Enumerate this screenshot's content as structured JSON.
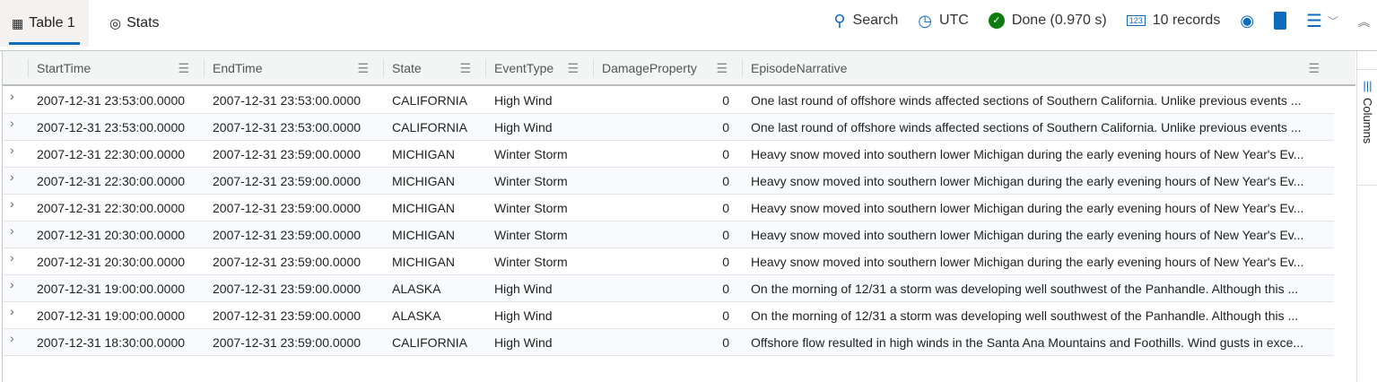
{
  "tabs": [
    {
      "label": "Table 1",
      "icon": "table-icon"
    },
    {
      "label": "Stats",
      "icon": "stats-icon"
    }
  ],
  "toolbar": {
    "search": "Search",
    "timezone": "UTC",
    "status": "Done (0.970 s)",
    "records": "10 records"
  },
  "side": {
    "columns": "Columns"
  },
  "columns": [
    "StartTime",
    "EndTime",
    "State",
    "EventType",
    "DamageProperty",
    "EpisodeNarrative"
  ],
  "rows": [
    [
      "2007-12-31 23:53:00.0000",
      "2007-12-31 23:53:00.0000",
      "CALIFORNIA",
      "High Wind",
      "0",
      "One last round of offshore winds affected sections of Southern California. Unlike previous events ..."
    ],
    [
      "2007-12-31 23:53:00.0000",
      "2007-12-31 23:53:00.0000",
      "CALIFORNIA",
      "High Wind",
      "0",
      "One last round of offshore winds affected sections of Southern California. Unlike previous events ..."
    ],
    [
      "2007-12-31 22:30:00.0000",
      "2007-12-31 23:59:00.0000",
      "MICHIGAN",
      "Winter Storm",
      "0",
      "Heavy snow moved into southern lower Michigan during the early evening hours of New Year's Ev..."
    ],
    [
      "2007-12-31 22:30:00.0000",
      "2007-12-31 23:59:00.0000",
      "MICHIGAN",
      "Winter Storm",
      "0",
      "Heavy snow moved into southern lower Michigan during the early evening hours of New Year's Ev..."
    ],
    [
      "2007-12-31 22:30:00.0000",
      "2007-12-31 23:59:00.0000",
      "MICHIGAN",
      "Winter Storm",
      "0",
      "Heavy snow moved into southern lower Michigan during the early evening hours of New Year's Ev..."
    ],
    [
      "2007-12-31 20:30:00.0000",
      "2007-12-31 23:59:00.0000",
      "MICHIGAN",
      "Winter Storm",
      "0",
      "Heavy snow moved into southern lower Michigan during the early evening hours of New Year's Ev..."
    ],
    [
      "2007-12-31 20:30:00.0000",
      "2007-12-31 23:59:00.0000",
      "MICHIGAN",
      "Winter Storm",
      "0",
      "Heavy snow moved into southern lower Michigan during the early evening hours of New Year's Ev..."
    ],
    [
      "2007-12-31 19:00:00.0000",
      "2007-12-31 23:59:00.0000",
      "ALASKA",
      "High Wind",
      "0",
      "On the morning of 12/31 a storm was developing well southwest of the Panhandle. Although this ..."
    ],
    [
      "2007-12-31 19:00:00.0000",
      "2007-12-31 23:59:00.0000",
      "ALASKA",
      "High Wind",
      "0",
      "On the morning of 12/31 a storm was developing well southwest of the Panhandle. Although this ..."
    ],
    [
      "2007-12-31 18:30:00.0000",
      "2007-12-31 23:59:00.0000",
      "CALIFORNIA",
      "High Wind",
      "0",
      "Offshore flow resulted in high winds in the Santa Ana Mountains and Foothills. Wind gusts in exce..."
    ]
  ],
  "colors": {
    "accent": "#0f6cbd",
    "success": "#107c10"
  }
}
